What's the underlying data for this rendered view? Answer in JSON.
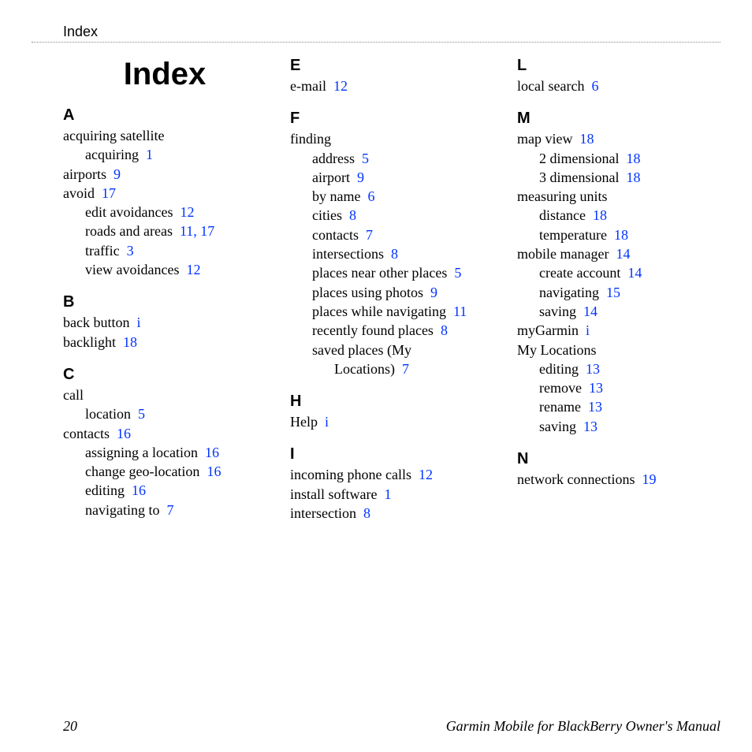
{
  "header": "Index",
  "title": "Index",
  "footer": {
    "page": "20",
    "manual": "Garmin Mobile for BlackBerry Owner's Manual"
  },
  "columns": [
    {
      "title_here": true,
      "sections": [
        {
          "letter": "A",
          "items": [
            {
              "text": "acquiring satellite",
              "pages": "",
              "indent": 0
            },
            {
              "text": "acquiring",
              "pages": "1",
              "indent": 1
            },
            {
              "text": "airports",
              "pages": "9",
              "indent": 0
            },
            {
              "text": "avoid",
              "pages": "17",
              "indent": 0
            },
            {
              "text": "edit avoidances",
              "pages": "12",
              "indent": 1
            },
            {
              "text": "roads and areas",
              "pages": "11, 17",
              "indent": 1
            },
            {
              "text": "traffic",
              "pages": "3",
              "indent": 1
            },
            {
              "text": "view avoidances",
              "pages": "12",
              "indent": 1
            }
          ]
        },
        {
          "letter": "B",
          "items": [
            {
              "text": "back button",
              "pages": "i",
              "indent": 0
            },
            {
              "text": "backlight",
              "pages": "18",
              "indent": 0
            }
          ]
        },
        {
          "letter": "C",
          "items": [
            {
              "text": "call",
              "pages": "",
              "indent": 0
            },
            {
              "text": "location",
              "pages": "5",
              "indent": 1
            },
            {
              "text": "contacts",
              "pages": "16",
              "indent": 0
            },
            {
              "text": "assigning a location",
              "pages": "16",
              "indent": 1
            },
            {
              "text": "change geo-location",
              "pages": "16",
              "indent": 1
            },
            {
              "text": "editing",
              "pages": "16",
              "indent": 1
            },
            {
              "text": "navigating to",
              "pages": "7",
              "indent": 1
            }
          ]
        }
      ]
    },
    {
      "title_here": false,
      "sections": [
        {
          "letter": "E",
          "items": [
            {
              "text": "e-mail",
              "pages": "12",
              "indent": 0
            }
          ]
        },
        {
          "letter": "F",
          "items": [
            {
              "text": "finding",
              "pages": "",
              "indent": 0
            },
            {
              "text": "address",
              "pages": "5",
              "indent": 1
            },
            {
              "text": "airport",
              "pages": "9",
              "indent": 1
            },
            {
              "text": "by name",
              "pages": "6",
              "indent": 1
            },
            {
              "text": "cities",
              "pages": "8",
              "indent": 1
            },
            {
              "text": "contacts",
              "pages": "7",
              "indent": 1
            },
            {
              "text": "intersections",
              "pages": "8",
              "indent": 1
            },
            {
              "text": "places near other places",
              "pages": "5",
              "indent": 1
            },
            {
              "text": "places using photos",
              "pages": "9",
              "indent": 1
            },
            {
              "text": "places while navigating",
              "pages": "11",
              "indent": 1
            },
            {
              "text": "recently found places",
              "pages": "8",
              "indent": 1
            },
            {
              "text": "saved places (My",
              "pages": "",
              "indent": 1
            },
            {
              "text": "Locations)",
              "pages": "7",
              "indent": 2
            }
          ]
        },
        {
          "letter": "H",
          "items": [
            {
              "text": "Help",
              "pages": "i",
              "indent": 0
            }
          ]
        },
        {
          "letter": "I",
          "items": [
            {
              "text": "incoming phone calls",
              "pages": "12",
              "indent": 0
            },
            {
              "text": "install software",
              "pages": "1",
              "indent": 0
            },
            {
              "text": "intersection",
              "pages": "8",
              "indent": 0
            }
          ]
        }
      ]
    },
    {
      "title_here": false,
      "sections": [
        {
          "letter": "L",
          "items": [
            {
              "text": "local search",
              "pages": "6",
              "indent": 0
            }
          ]
        },
        {
          "letter": "M",
          "items": [
            {
              "text": "map view",
              "pages": "18",
              "indent": 0
            },
            {
              "text": "2 dimensional",
              "pages": "18",
              "indent": 1
            },
            {
              "text": "3 dimensional",
              "pages": "18",
              "indent": 1
            },
            {
              "text": "measuring units",
              "pages": "",
              "indent": 0
            },
            {
              "text": "distance",
              "pages": "18",
              "indent": 1
            },
            {
              "text": "temperature",
              "pages": "18",
              "indent": 1
            },
            {
              "text": "mobile manager",
              "pages": "14",
              "indent": 0
            },
            {
              "text": "create account",
              "pages": "14",
              "indent": 1
            },
            {
              "text": "navigating",
              "pages": "15",
              "indent": 1
            },
            {
              "text": "saving",
              "pages": "14",
              "indent": 1
            },
            {
              "text": "myGarmin",
              "pages": "i",
              "indent": 0
            },
            {
              "text": "My Locations",
              "pages": "",
              "indent": 0
            },
            {
              "text": "editing",
              "pages": "13",
              "indent": 1
            },
            {
              "text": "remove",
              "pages": "13",
              "indent": 1
            },
            {
              "text": "rename",
              "pages": "13",
              "indent": 1
            },
            {
              "text": "saving",
              "pages": "13",
              "indent": 1
            }
          ]
        },
        {
          "letter": "N",
          "items": [
            {
              "text": "network connections",
              "pages": "19",
              "indent": 0
            }
          ]
        }
      ]
    }
  ]
}
